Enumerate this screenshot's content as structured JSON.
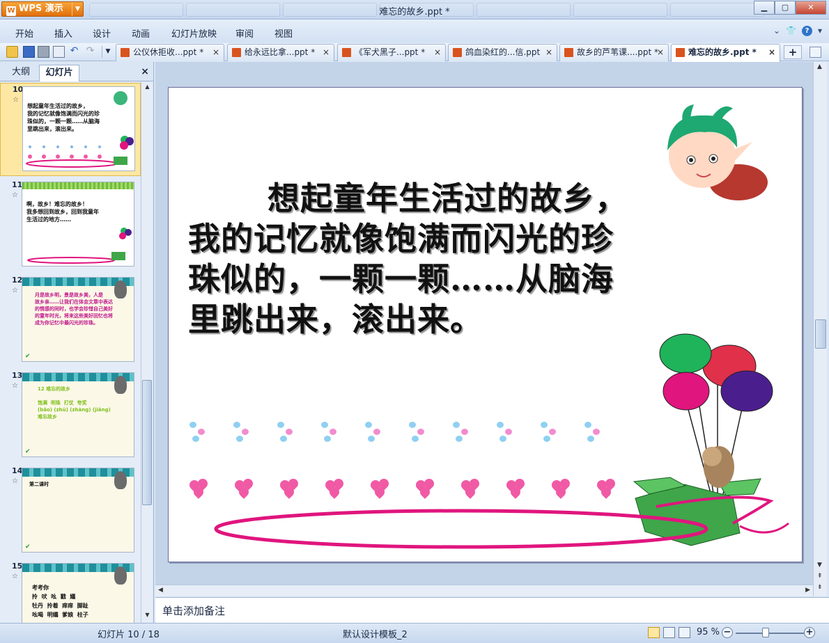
{
  "window": {
    "app_button": "WPS 演示",
    "title": "难忘的故乡.ppt *"
  },
  "menu": [
    "开始",
    "插入",
    "设计",
    "动画",
    "幻灯片放映",
    "审阅",
    "视图"
  ],
  "doc_tabs": [
    {
      "label": "公仪休拒收...ppt *",
      "active": false
    },
    {
      "label": "给永远比拿...ppt *",
      "active": false
    },
    {
      "label": "《军犬黑子...ppt *",
      "active": false
    },
    {
      "label": "鸽血染红的...信.ppt",
      "active": false
    },
    {
      "label": "故乡的芦苇课....ppt *",
      "active": false
    },
    {
      "label": "难忘的故乡.ppt *",
      "active": true
    }
  ],
  "left_pane": {
    "tab_outline": "大纲",
    "tab_slides": "幻灯片",
    "thumbnails": [
      {
        "num": "10",
        "text": "想起童年生活过的故乡，\n我的记忆就像饱满而闪光的珍\n珠似的，一颗一颗……从脑海\n里跳出来，滚出来。"
      },
      {
        "num": "11",
        "text": "啊，故乡！难忘的故乡！\n我多想回到故乡，回到我童年\n生活过的地方……"
      },
      {
        "num": "12",
        "text": "月是故乡明，景是故乡美，人是\n故乡亲……让我们在体会文章中表达\n的情感的同时，也学会珍惜自己美好\n的童年时光，将来这些美好回忆也将\n成为你记忆中最闪光的珍珠。"
      },
      {
        "num": "13",
        "text": "12 难忘的故乡\n\n饱满  明珠  打仗  夸奖\n(bǎo) (zhū) (zhàng) (jiǎng)\n难忘故乡"
      },
      {
        "num": "14",
        "text": "第二课时"
      },
      {
        "num": "15",
        "text": "考考你\n拎  吠  吆  戳  孀\n牡丹  拎着  痒痒  脚趾\n吆喝  明孀  爹娘  柱子"
      }
    ]
  },
  "slide": {
    "text": "想起童年生活过的故乡，\n我的记忆就像饱满而闪光的珍\n珠似的，一颗一颗……从脑海\n里跳出来，滚出来。"
  },
  "notes_placeholder": "单击添加备注",
  "status": {
    "slide_index": "幻灯片 10 / 18",
    "template": "默认设计模板_2",
    "zoom": "95 %"
  },
  "colors": {
    "accent": "#e0700d",
    "balloon_green": "#1fb45a",
    "balloon_red": "#e0304a",
    "balloon_magenta": "#e0157e",
    "balloon_purple": "#4b1e8e",
    "ribbon_pink": "#e0157e"
  }
}
